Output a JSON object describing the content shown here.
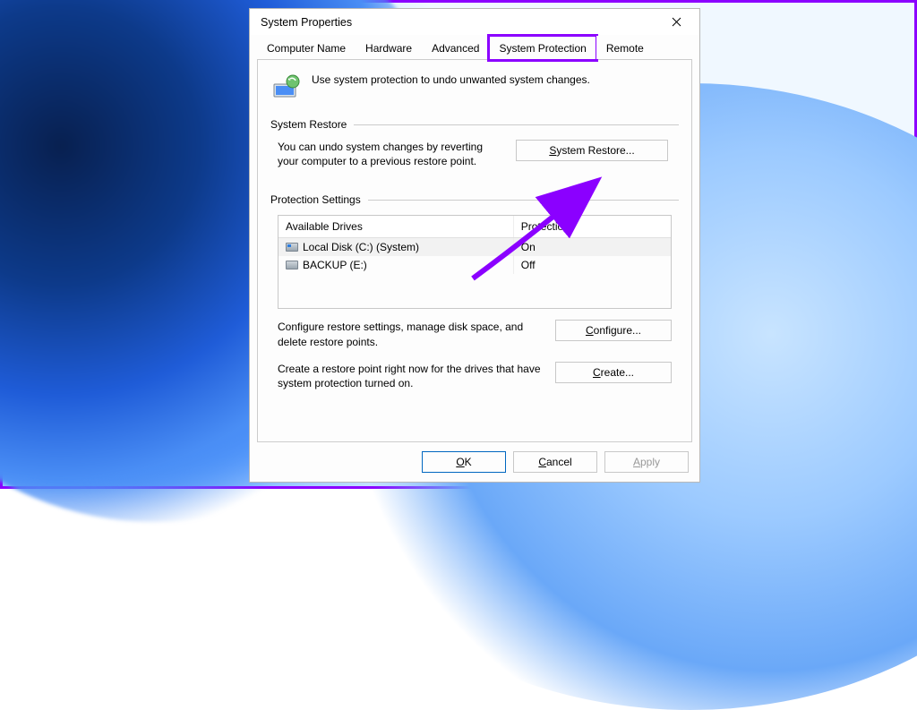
{
  "window": {
    "title": "System Properties"
  },
  "tabs": {
    "computer_name": "Computer Name",
    "hardware": "Hardware",
    "advanced": "Advanced",
    "system_protection": "System Protection",
    "remote": "Remote"
  },
  "intro": "Use system protection to undo unwanted system changes.",
  "system_restore": {
    "group_label": "System Restore",
    "desc": "You can undo system changes by reverting your computer to a previous restore point.",
    "button": "System Restore..."
  },
  "protection_settings": {
    "group_label": "Protection Settings",
    "headers": {
      "drives": "Available Drives",
      "protection": "Protection"
    },
    "rows": [
      {
        "name": "Local Disk (C:) (System)",
        "protection": "On"
      },
      {
        "name": "BACKUP (E:)",
        "protection": "Off"
      }
    ],
    "configure_desc": "Configure restore settings, manage disk space, and delete restore points.",
    "configure_btn": "Configure...",
    "create_desc": "Create a restore point right now for the drives that have system protection turned on.",
    "create_btn": "Create..."
  },
  "buttons": {
    "ok": "OK",
    "cancel": "Cancel",
    "apply": "Apply"
  }
}
